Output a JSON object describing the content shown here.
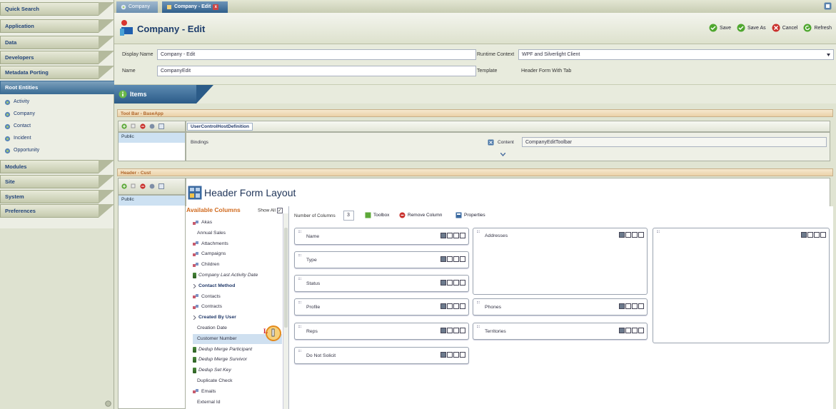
{
  "sidebar": {
    "categories": [
      "Quick Search",
      "Application",
      "Data",
      "Developers",
      "Metadata Porting",
      "Root Entities",
      "Modules",
      "Site",
      "System",
      "Preferences"
    ],
    "entities": [
      "Activity",
      "Company",
      "Contact",
      "Incident",
      "Opportunity"
    ]
  },
  "tabs": {
    "tab1": "Company",
    "tab2": "Company - Edit",
    "close": "x"
  },
  "header": {
    "title": "Company - Edit",
    "save": "Save",
    "save_as": "Save As",
    "cancel": "Cancel",
    "refresh": "Refresh"
  },
  "form": {
    "display_name_label": "Display Name",
    "display_name_value": "Company - Edit",
    "name_label": "Name",
    "name_value": "CompanyEdit",
    "runtime_label": "Runtime Context",
    "runtime_value": "WPF and Silverlight Client",
    "template_label": "Template",
    "template_value": "Header Form With Tab"
  },
  "items_title": "Items",
  "toolbar_section": {
    "title": "Tool Bar - BaseApp",
    "public": "Public",
    "control": "UserControlHostDefinition",
    "bindings": "Bindings",
    "content_label": "Content",
    "content_value": "CompanyEditToolbar"
  },
  "header_section": {
    "title": "Header - Cust",
    "public": "Public",
    "layout_title": "Header Form Layout",
    "available_columns": "Available Columns",
    "show_all": "Show All",
    "num_columns_label": "Number of Columns",
    "num_columns_value": "3",
    "toolbox": "Toolbox",
    "remove_column": "Remove Column",
    "properties": "Properties"
  },
  "columns": [
    {
      "label": "Akas",
      "kind": "rel"
    },
    {
      "label": "Annual Sales",
      "kind": "plain"
    },
    {
      "label": "Attachments",
      "kind": "rel"
    },
    {
      "label": "Campaigns",
      "kind": "rel"
    },
    {
      "label": "Children",
      "kind": "rel"
    },
    {
      "label": "Company Last Activity Date",
      "kind": "db"
    },
    {
      "label": "Contact Method",
      "kind": "group"
    },
    {
      "label": "Contacts",
      "kind": "rel"
    },
    {
      "label": "Contracts",
      "kind": "rel"
    },
    {
      "label": "Created By User",
      "kind": "group"
    },
    {
      "label": "Creation Date",
      "kind": "plain"
    },
    {
      "label": "Customer Number",
      "kind": "selected"
    },
    {
      "label": "Dedup Merge Participant",
      "kind": "db"
    },
    {
      "label": "Dedup Merge Survivor",
      "kind": "db"
    },
    {
      "label": "Dedup Set Key",
      "kind": "db"
    },
    {
      "label": "Duplicate Check",
      "kind": "plain"
    },
    {
      "label": "Emails",
      "kind": "rel"
    },
    {
      "label": "External Id",
      "kind": "plain"
    }
  ],
  "layout_fields": {
    "col1": [
      "Name",
      "Type",
      "Status",
      "Profile",
      "Reps",
      "Do Not Solicit"
    ],
    "addresses": "Addresses",
    "phones": "Phones",
    "territories": "Territories"
  },
  "cursor_mark": "L"
}
